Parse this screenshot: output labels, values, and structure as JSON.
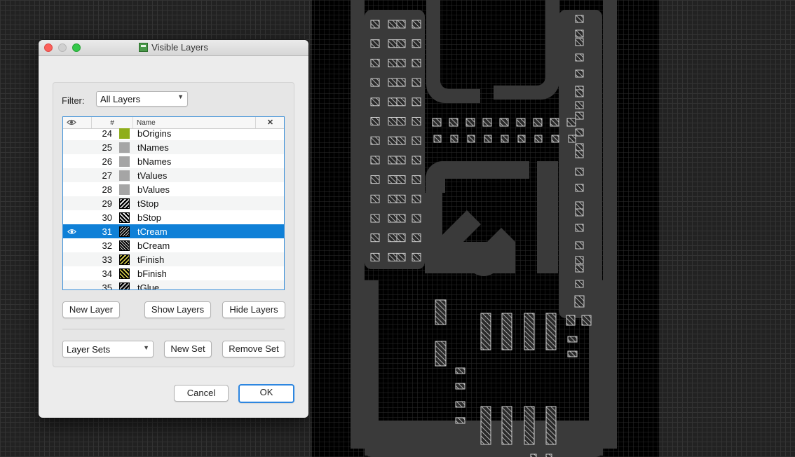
{
  "dialog": {
    "title": "Visible Layers",
    "title_icon": "app-icon",
    "filter_label": "Filter:",
    "filter_value": "All Layers",
    "table": {
      "columns": {
        "visible": "eye-icon",
        "number": "#",
        "name": "Name",
        "close": "✕"
      },
      "rows": [
        {
          "num": "24",
          "name": "bOrigins",
          "visible": false,
          "swatch": "solid-olive",
          "color": "#8fae1b"
        },
        {
          "num": "25",
          "name": "tNames",
          "visible": false,
          "swatch": "solid-gray",
          "color": "#a5a5a5"
        },
        {
          "num": "26",
          "name": "bNames",
          "visible": false,
          "swatch": "solid-gray",
          "color": "#a5a5a5"
        },
        {
          "num": "27",
          "name": "tValues",
          "visible": false,
          "swatch": "solid-gray",
          "color": "#a5a5a5"
        },
        {
          "num": "28",
          "name": "bValues",
          "visible": false,
          "swatch": "solid-gray",
          "color": "#a5a5a5"
        },
        {
          "num": "29",
          "name": "tStop",
          "visible": false,
          "swatch": "hatch-forward",
          "color": "#ffffff"
        },
        {
          "num": "30",
          "name": "bStop",
          "visible": false,
          "swatch": "hatch-back",
          "color": "#ffffff"
        },
        {
          "num": "31",
          "name": "tCream",
          "visible": true,
          "selected": true,
          "swatch": "hatch-forward-fine",
          "color": "#c8c8c8"
        },
        {
          "num": "32",
          "name": "bCream",
          "visible": false,
          "swatch": "hatch-back-fine",
          "color": "#c8c8c8"
        },
        {
          "num": "33",
          "name": "tFinish",
          "visible": false,
          "swatch": "hatch-forward",
          "color": "#e6dc50"
        },
        {
          "num": "34",
          "name": "bFinish",
          "visible": false,
          "swatch": "hatch-back",
          "color": "#e6dc50"
        },
        {
          "num": "35",
          "name": "tGlue",
          "visible": false,
          "swatch": "hatch-forward",
          "color": "#c8c8c8"
        }
      ]
    },
    "buttons": {
      "new_layer": "New Layer",
      "show_layers": "Show Layers",
      "hide_layers": "Hide Layers",
      "new_set": "New Set",
      "remove_set": "Remove Set",
      "cancel": "Cancel",
      "ok": "OK"
    },
    "layer_sets_value": "Layer Sets"
  },
  "colors": {
    "selection": "#0f80d7",
    "accent": "#2d86e0",
    "canvas": "#222222",
    "board": "#000000",
    "board_feature": "#3a3a3a"
  }
}
